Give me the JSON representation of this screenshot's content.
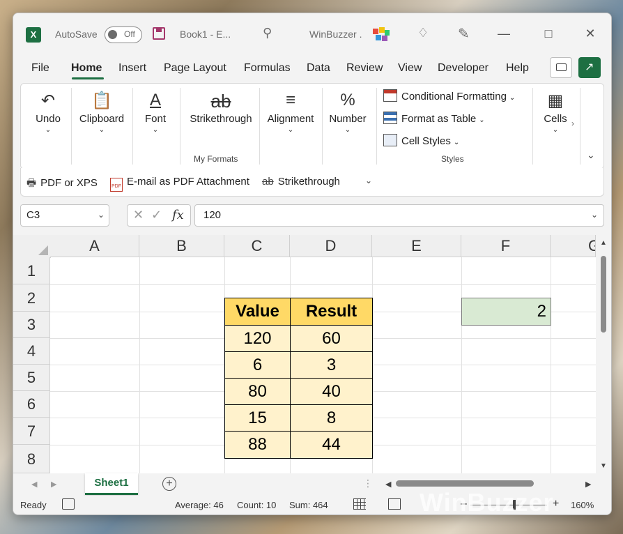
{
  "titlebar": {
    "app_logo": "X",
    "autosave_label": "AutoSave",
    "autosave_state": "Off",
    "book_title": "Book1  -  E...",
    "window_title": "WinBuzzer ."
  },
  "menu": {
    "items": [
      "File",
      "Home",
      "Insert",
      "Page Layout",
      "Formulas",
      "Data",
      "Review",
      "View",
      "Developer",
      "Help"
    ],
    "active": "Home"
  },
  "ribbon": {
    "undo": "Undo",
    "clipboard": "Clipboard",
    "font": "Font",
    "strikethrough": "Strikethrough",
    "my_formats_label": "My Formats",
    "alignment": "Alignment",
    "number": "Number",
    "conditional_formatting": "Conditional Formatting",
    "format_as_table": "Format as Table",
    "cell_styles": "Cell Styles",
    "styles_label": "Styles",
    "cells": "Cells"
  },
  "qat": {
    "pdf_xps": "PDF or XPS",
    "email_pdf": "E-mail as PDF Attachment",
    "strikethrough": "Strikethrough",
    "pdf_badge": "PDF"
  },
  "formula_bar": {
    "name_box": "C3",
    "value": "120",
    "fx": "fx"
  },
  "grid": {
    "columns": [
      "A",
      "B",
      "C",
      "D",
      "E",
      "F",
      "G"
    ],
    "rows": [
      "1",
      "2",
      "3",
      "4",
      "5",
      "6",
      "7",
      "8"
    ],
    "table_headers": [
      "Value",
      "Result"
    ],
    "table_rows": [
      [
        "120",
        "60"
      ],
      [
        "6",
        "3"
      ],
      [
        "80",
        "40"
      ],
      [
        "15",
        "8"
      ],
      [
        "88",
        "44"
      ]
    ],
    "f2_value": "2"
  },
  "sheets": {
    "active": "Sheet1"
  },
  "status": {
    "ready": "Ready",
    "average": "Average: 46",
    "count": "Count: 10",
    "sum": "Sum: 464",
    "zoom": "160%"
  },
  "watermark": "WinBuzzer",
  "colors": {
    "excel_green": "#1d6f42",
    "table_header": "#ffd966",
    "table_body": "#fff2cc",
    "f2_fill": "#d9ead3"
  }
}
